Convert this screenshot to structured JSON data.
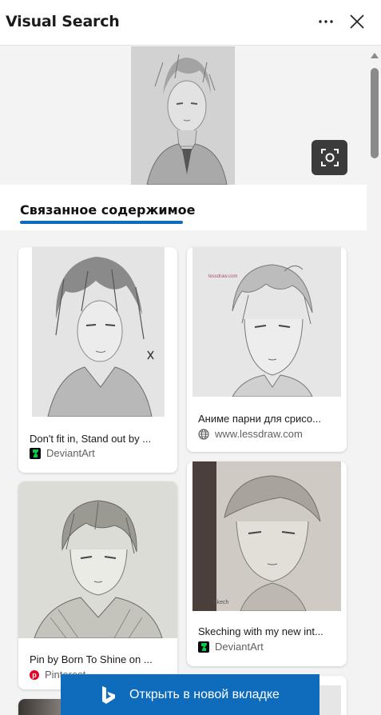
{
  "header": {
    "title": "Visual Search"
  },
  "tabs": {
    "related_label": "Связанное содержимое"
  },
  "results": [
    {
      "caption": "Don't fit in, Stand out by ...",
      "source": "DeviantArt",
      "source_icon": "deviantart-icon"
    },
    {
      "caption": "Аниме парни для срисо...",
      "source": "www.lessdraw.com",
      "source_icon": "globe-icon"
    },
    {
      "caption": "Pin by Born To Shine on ...",
      "source": "Pinterest",
      "source_icon": "pinterest-icon"
    },
    {
      "caption": "Skeching with my new int...",
      "source": "DeviantArt",
      "source_icon": "deviantart-icon"
    }
  ],
  "footer": {
    "open_label": "Открыть в новой вкладке"
  },
  "colors": {
    "accent": "#0f6cbd",
    "panel_bg": "#f3f3f3",
    "card_bg": "#ffffff"
  }
}
